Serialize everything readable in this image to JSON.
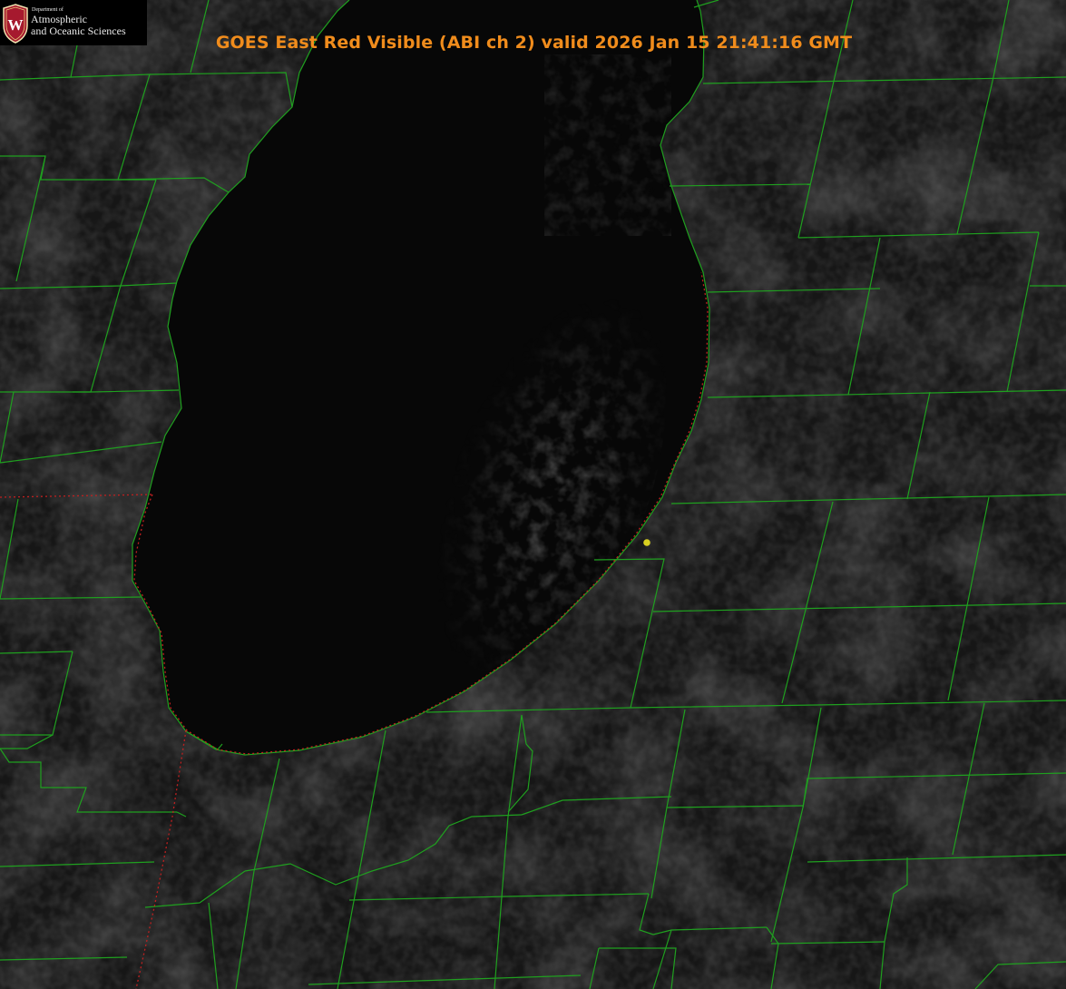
{
  "title": "GOES East Red Visible (ABI ch 2) valid 2026 Jan 15 21:41:16 GMT",
  "logo": {
    "department": "Department of",
    "line1": "Atmospheric",
    "line2": "and Oceanic Sciences",
    "crest_letter": "W",
    "crest_color": "#a6192e"
  },
  "colors": {
    "background": "#161616",
    "lake": "#070707",
    "county_lines": "#1fa01f",
    "state_line": "#c02020",
    "marker": "#d8d020",
    "title": "#f08c1c"
  },
  "marker": {
    "label": ""
  }
}
